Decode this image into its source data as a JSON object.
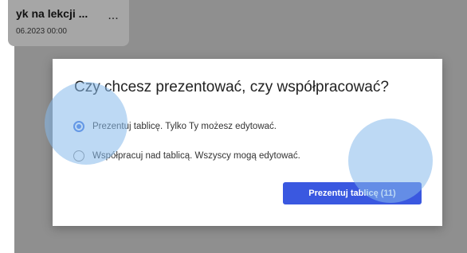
{
  "background_card": {
    "title": "yk na lekcji ...",
    "date": "06.2023 00:00",
    "more_label": "..."
  },
  "dialog": {
    "title": "Czy chcesz prezentować, czy współpracować?",
    "options": [
      {
        "label": "Prezentuj tablicę. Tylko Ty możesz edytować.",
        "checked": true
      },
      {
        "label": "Współpracuj nad tablicą. Wszyscy mogą edytować.",
        "checked": false
      }
    ],
    "primary_button": "Prezentuj tablicę (11)"
  },
  "colors": {
    "accent": "#3a58e0",
    "radio_selected": "#3a6fe0",
    "touch_indicator": "#87b9eb",
    "overlay": "#8f8f8f"
  }
}
